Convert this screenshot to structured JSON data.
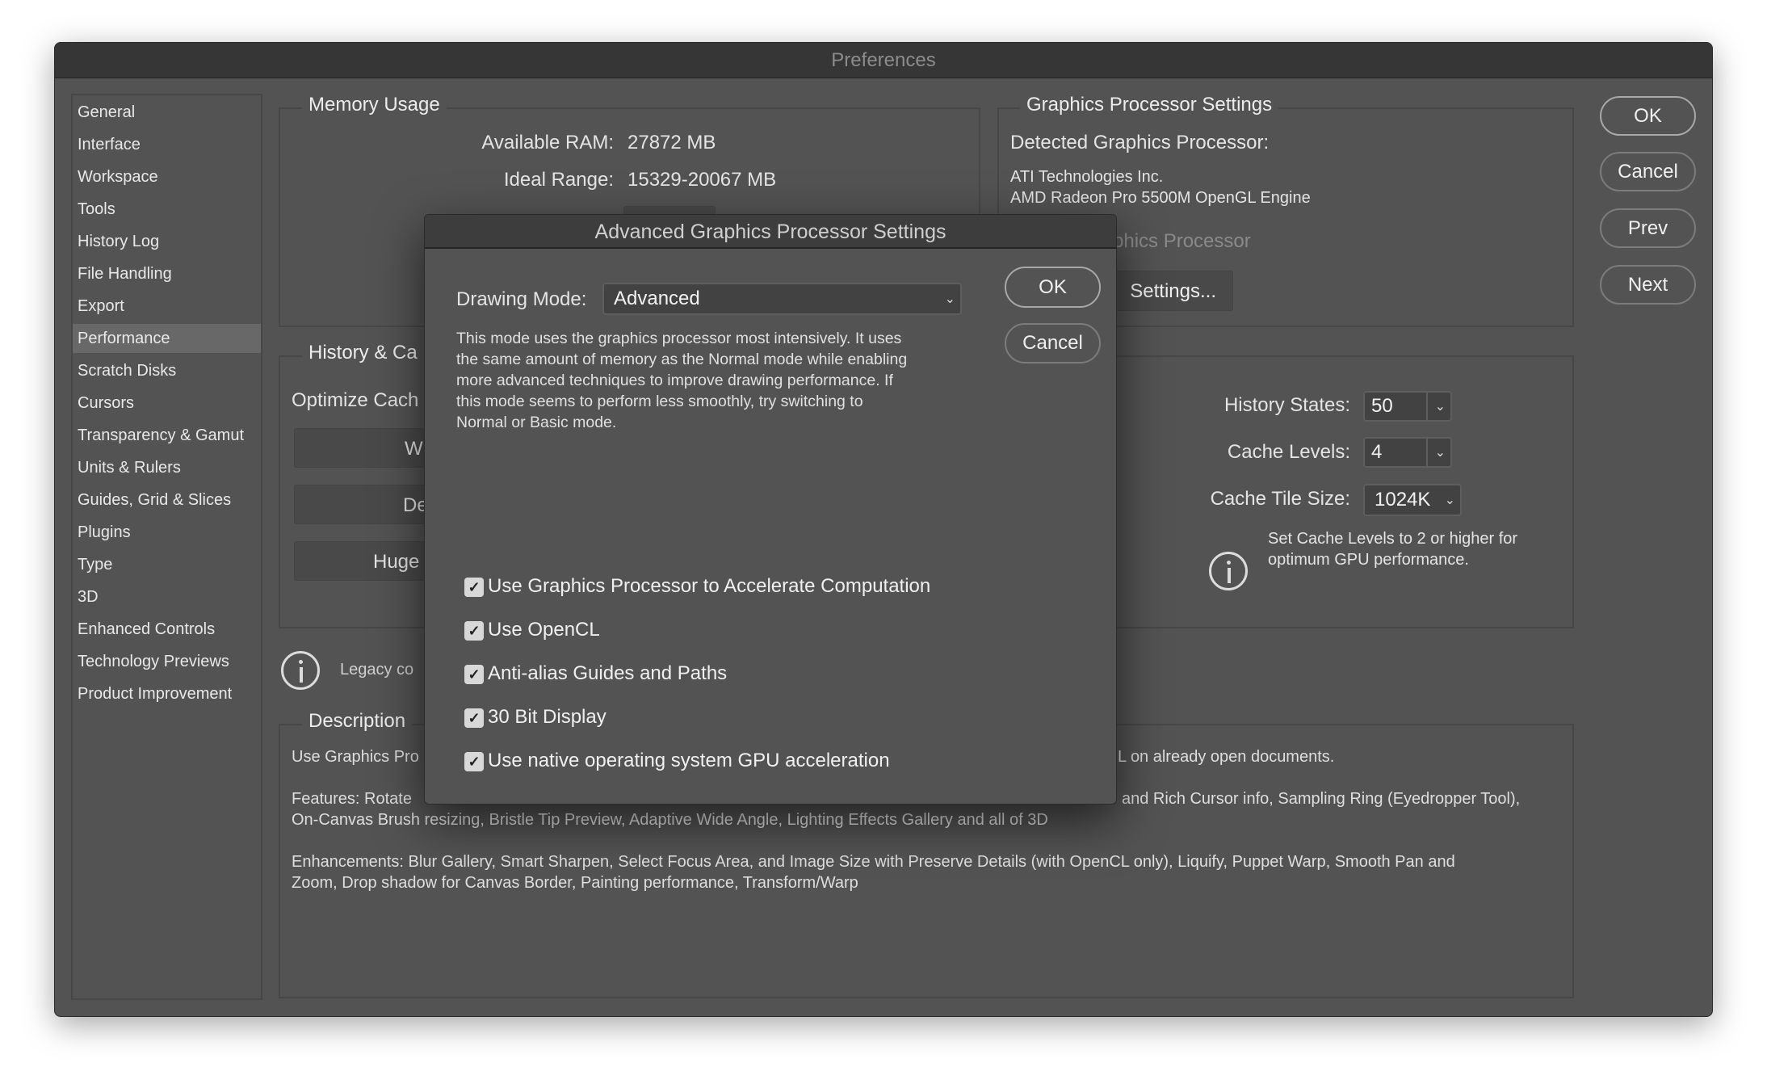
{
  "window": {
    "title": "Preferences"
  },
  "sidebar": {
    "items": [
      "General",
      "Interface",
      "Workspace",
      "Tools",
      "History Log",
      "File Handling",
      "Export",
      "Performance",
      "Scratch Disks",
      "Cursors",
      "Transparency & Gamut",
      "Units & Rulers",
      "Guides, Grid & Slices",
      "Plugins",
      "Type",
      "3D",
      "Enhanced Controls",
      "Technology Previews",
      "Product Improvement"
    ],
    "selected": "Performance"
  },
  "memory": {
    "title": "Memory Usage",
    "available_label": "Available RAM:",
    "available_value": "27872 MB",
    "ideal_label": "Ideal Range:",
    "ideal_value": "15329-20067 MB"
  },
  "gpu": {
    "title": "Graphics Processor Settings",
    "detected_label": "Detected Graphics Processor:",
    "vendor": "ATI Technologies Inc.",
    "model": "AMD Radeon Pro 5500M OpenGL Engine",
    "use_gpu_partial": "phics Processor",
    "settings_button_partial": "Settings..."
  },
  "history": {
    "title_partial": "History & Ca",
    "optimize_partial": "Optimize Cach",
    "buttons_partial": [
      "W",
      "De",
      "Huge"
    ],
    "history_states_label": "History States:",
    "history_states": "50",
    "cache_levels_label": "Cache Levels:",
    "cache_levels": "4",
    "tile_size_label": "Cache Tile Size:",
    "tile_size": "1024K",
    "note": [
      "Set Cache Levels to 2 or higher for",
      "optimum GPU performance."
    ]
  },
  "legacy_partial": "Legacy co",
  "description": {
    "title": "Description",
    "line1_left": "Use Graphics Pro",
    "line1_right": "L on already open documents.",
    "line2_left": "Features: Rotate",
    "line2_right": "and Rich Cursor info, Sampling Ring (Eyedropper Tool),",
    "line3": "On-Canvas Brush resizing, Bristle Tip Preview, Adaptive Wide Angle, Lighting Effects Gallery and all of 3D",
    "line4": "Enhancements: Blur Gallery, Smart Sharpen, Select Focus Area, and Image Size with Preserve Details (with OpenCL only), Liquify, Puppet Warp, Smooth Pan and",
    "line5": "Zoom, Drop shadow for Canvas Border, Painting performance, Transform/Warp"
  },
  "buttons": {
    "ok": "OK",
    "cancel": "Cancel",
    "prev": "Prev",
    "next": "Next"
  },
  "dialog": {
    "title": "Advanced Graphics Processor Settings",
    "drawing_mode_label": "Drawing Mode:",
    "drawing_mode": "Advanced",
    "ok": "OK",
    "cancel": "Cancel",
    "help": [
      "This mode uses the graphics processor most intensively.  It uses",
      "the same amount of memory as the Normal mode while enabling",
      "more advanced techniques to improve drawing performance.  If",
      "this mode seems to perform less smoothly, try switching to",
      "Normal or Basic mode."
    ],
    "checkboxes": [
      {
        "label": "Use Graphics Processor to Accelerate Computation",
        "checked": true
      },
      {
        "label": "Use OpenCL",
        "checked": true
      },
      {
        "label": "Anti-alias Guides and Paths",
        "checked": true
      },
      {
        "label": "30 Bit Display",
        "checked": true
      },
      {
        "label": "Use native operating system GPU acceleration",
        "checked": true
      }
    ]
  },
  "icons": {
    "info": "info-circle-icon",
    "chevron": "chevron-down-icon",
    "check": "checkmark-icon"
  }
}
